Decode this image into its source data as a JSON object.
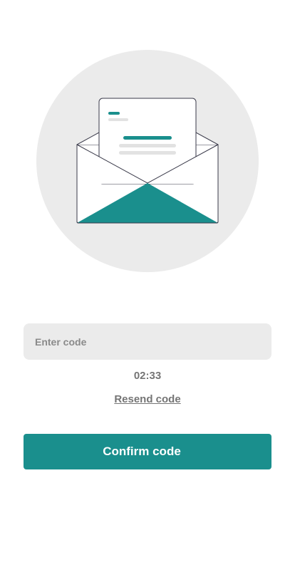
{
  "illustration": {
    "icon": "open-envelope-with-letter-icon",
    "circle_color": "#ebebeb",
    "accent_color": "#1a8f8d"
  },
  "code_input": {
    "placeholder": "Enter code",
    "value": ""
  },
  "timer": {
    "text": "02:33"
  },
  "resend": {
    "label": "Resend code"
  },
  "confirm": {
    "label": "Confirm code",
    "color": "#1a8f8d"
  }
}
